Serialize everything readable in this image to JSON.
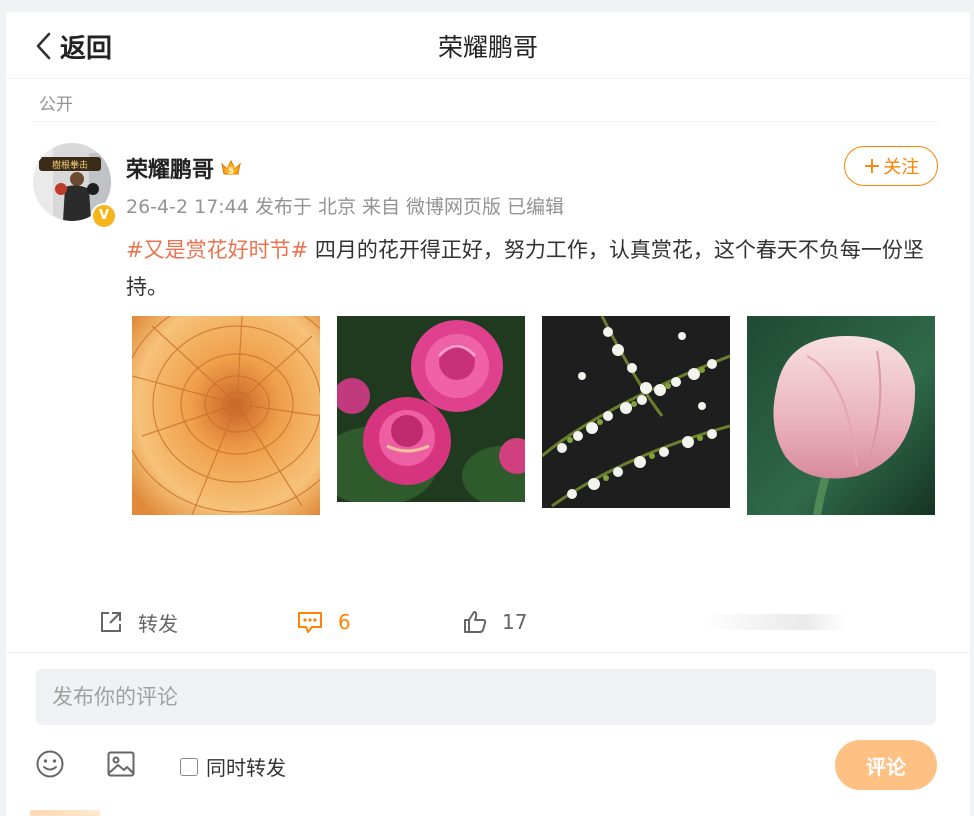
{
  "header": {
    "back_label": "返回",
    "title": "荣耀鹏哥"
  },
  "visibility": "公开",
  "author": {
    "name": "荣耀鹏哥",
    "avatar_caption": "樹根拳击",
    "verified_badge": "V",
    "meta": "26-4-2 17:44 发布于 北京 来自 微博网页版 已编辑",
    "follow_label": "关注"
  },
  "post": {
    "topic": "#又是赏花好时节#",
    "text": " 四月的花开得正好，努力工作，认真赏花，这个春天不负每一份坚持。"
  },
  "images": [
    {
      "name": "orange-dahlia-image"
    },
    {
      "name": "pink-strawflower-image"
    },
    {
      "name": "white-blossom-branch-image"
    },
    {
      "name": "pink-tulip-image"
    }
  ],
  "actions": {
    "repost_label": "转发",
    "comment_count": "6",
    "like_count": "17"
  },
  "comment_box": {
    "placeholder": "发布你的评论",
    "also_repost_label": "同时转发",
    "submit_label": "评论"
  },
  "colors": {
    "accent": "#ff8200",
    "topic": "#eb7350",
    "submit_disabled": "#ffc183"
  }
}
